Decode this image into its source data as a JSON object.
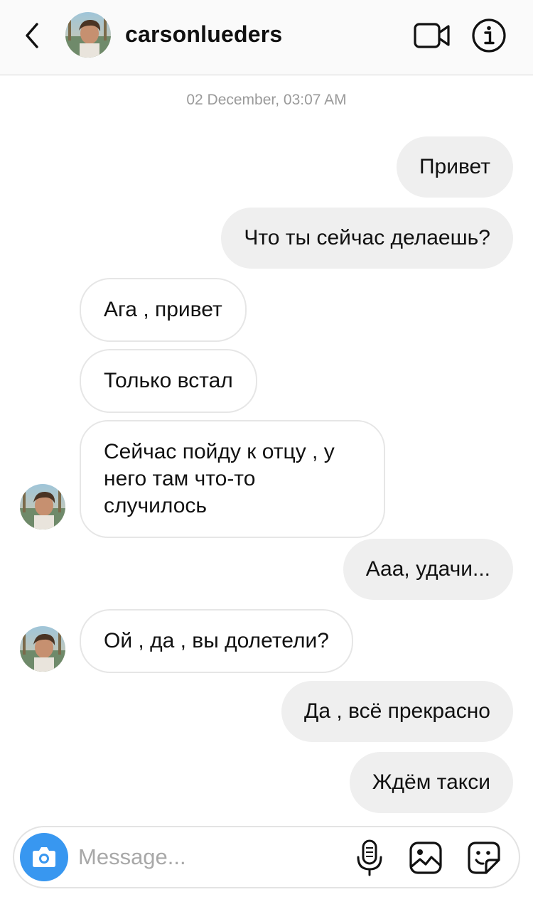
{
  "header": {
    "username": "carsonlueders"
  },
  "thread": {
    "timestamp": "02 December, 03:07 AM",
    "messages": [
      {
        "direction": "outgoing",
        "text": "Привет"
      },
      {
        "direction": "outgoing",
        "text": "Что ты сейчас делаешь?"
      },
      {
        "direction": "incoming",
        "text": "Ага , привет"
      },
      {
        "direction": "incoming",
        "text": "Только встал"
      },
      {
        "direction": "incoming",
        "text": "Сейчас пойду к отцу , у него там что-то случилось"
      },
      {
        "direction": "outgoing",
        "text": "Ааа, удачи..."
      },
      {
        "direction": "incoming",
        "text": "Ой , да , вы долетели?"
      },
      {
        "direction": "outgoing",
        "text": "Да , всё прекрасно"
      },
      {
        "direction": "outgoing",
        "text": "Ждём такси"
      }
    ]
  },
  "composer": {
    "placeholder": "Message...",
    "value": ""
  },
  "icons": {
    "back": "chevron-left-icon",
    "video": "video-camera-icon",
    "info": "info-icon",
    "camera": "camera-icon",
    "mic": "microphone-icon",
    "gallery": "image-gallery-icon",
    "sticker": "sticker-icon"
  },
  "colors": {
    "accent": "#3897f0",
    "outgoing_bubble": "#efefef",
    "incoming_border": "#e6e6e6",
    "timestamp": "#9a9a9a"
  }
}
